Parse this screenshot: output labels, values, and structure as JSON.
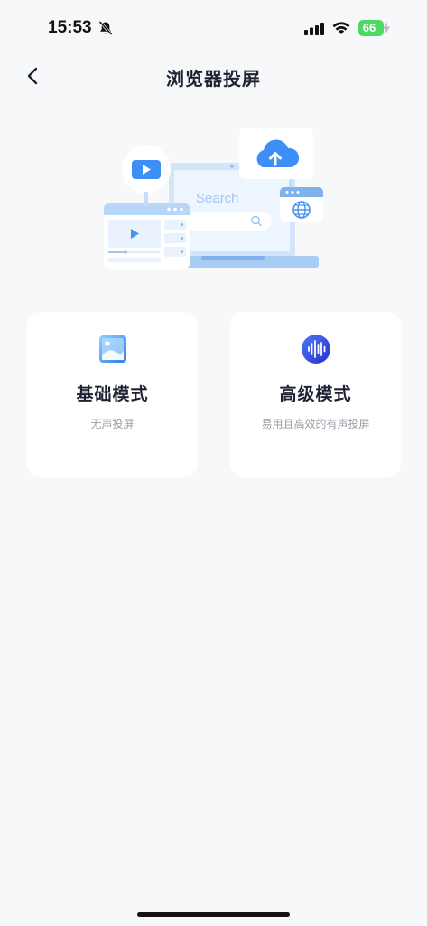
{
  "status_bar": {
    "time": "15:53",
    "battery": "66",
    "icons": [
      "bell-muted-icon",
      "cellular-signal-icon",
      "wifi-icon",
      "battery-charging-icon"
    ]
  },
  "nav": {
    "back_icon": "chevron-left-icon",
    "title": "浏览器投屏"
  },
  "hero": {
    "search_placeholder": "Search",
    "icons": [
      "play-icon",
      "cloud-upload-icon",
      "globe-icon",
      "search-icon"
    ]
  },
  "modes": [
    {
      "title": "基础模式",
      "subtitle": "无声投屏",
      "icon": "image-icon",
      "accent": "#3d8ff5"
    },
    {
      "title": "高级模式",
      "subtitle": "易用且高效的有声投屏",
      "icon": "sound-wave-icon",
      "accent": "#3344dd"
    }
  ],
  "colors": {
    "background": "#f7f8fa",
    "card": "#ffffff",
    "title_text": "#1f2233",
    "subtitle_text": "#9a9ca6",
    "battery": "#4cd964"
  }
}
